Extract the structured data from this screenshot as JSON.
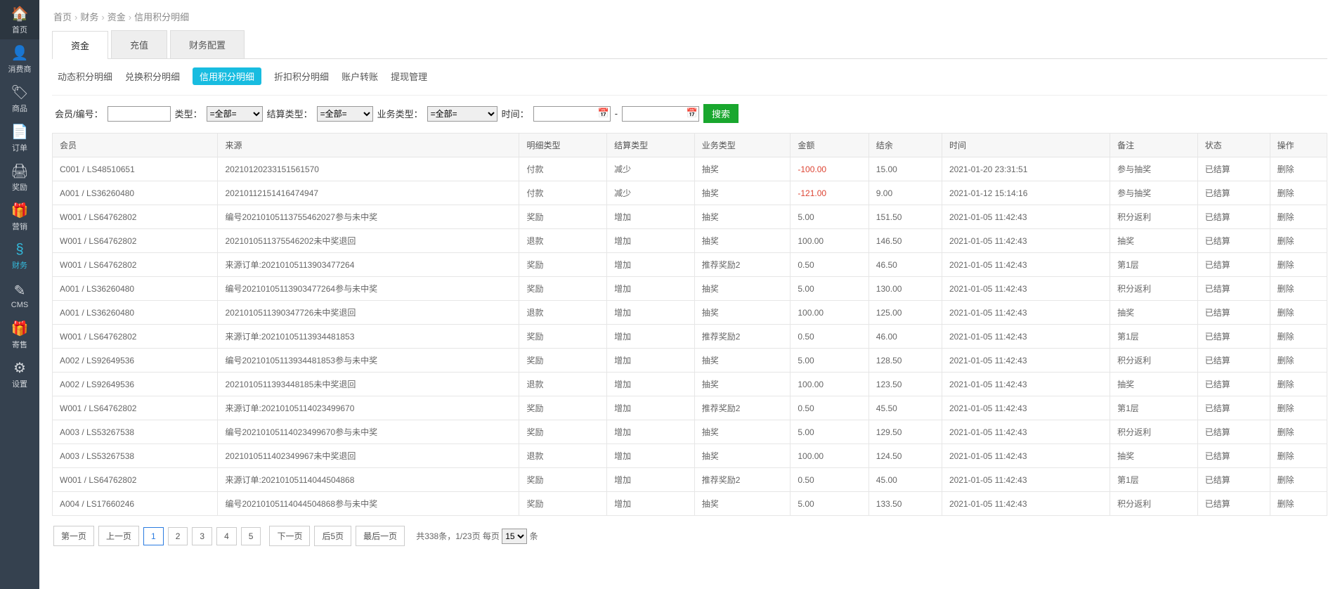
{
  "sidebar": [
    {
      "icon": "🏠",
      "label": "首页",
      "name": "sidebar-home"
    },
    {
      "icon": "👤",
      "label": "消费商",
      "name": "sidebar-consumer"
    },
    {
      "icon": "🏷",
      "label": "商品",
      "name": "sidebar-product"
    },
    {
      "icon": "📄",
      "label": "订单",
      "name": "sidebar-order"
    },
    {
      "icon": "🖨",
      "label": "奖励",
      "name": "sidebar-reward"
    },
    {
      "icon": "🎁",
      "label": "营销",
      "name": "sidebar-marketing"
    },
    {
      "icon": "§",
      "label": "财务",
      "name": "sidebar-finance",
      "active": true
    },
    {
      "icon": "✎",
      "label": "CMS",
      "name": "sidebar-cms"
    },
    {
      "icon": "🎁",
      "label": "寄售",
      "name": "sidebar-consign"
    },
    {
      "icon": "⚙",
      "label": "设置",
      "name": "sidebar-settings"
    }
  ],
  "breadcrumb": [
    "首页",
    "财务",
    "资金",
    "信用积分明细"
  ],
  "tabs1": [
    {
      "label": "资金",
      "active": true
    },
    {
      "label": "充值"
    },
    {
      "label": "财务配置"
    }
  ],
  "tabs2": [
    {
      "label": "动态积分明细"
    },
    {
      "label": "兑换积分明细"
    },
    {
      "label": "信用积分明细",
      "active": true
    },
    {
      "label": "折扣积分明细"
    },
    {
      "label": "账户转账"
    },
    {
      "label": "提现管理"
    }
  ],
  "filters": {
    "member_label": "会员/编号：",
    "type_label": "类型：",
    "type_opt": "=全部=",
    "settle_label": "结算类型：",
    "settle_opt": "=全部=",
    "biz_label": "业务类型：",
    "biz_opt": "=全部=",
    "time_label": "时间：",
    "dash": "-",
    "search": "搜索"
  },
  "columns": [
    "会员",
    "来源",
    "明细类型",
    "结算类型",
    "业务类型",
    "金额",
    "结余",
    "时间",
    "备注",
    "状态",
    "操作"
  ],
  "rows": [
    {
      "member": "C001 / LS48510651",
      "source": "20210120233151561570",
      "detail": "付款",
      "settle": "减少",
      "biz": "抽奖",
      "amount": "-100.00",
      "neg": true,
      "balance": "15.00",
      "time": "2021-01-20 23:31:51",
      "remark": "参与抽奖",
      "status": "已结算",
      "op": "删除"
    },
    {
      "member": "A001 / LS36260480",
      "source": "20210112151416474947",
      "detail": "付款",
      "settle": "减少",
      "biz": "抽奖",
      "amount": "-121.00",
      "neg": true,
      "balance": "9.00",
      "time": "2021-01-12 15:14:16",
      "remark": "参与抽奖",
      "status": "已结算",
      "op": "删除"
    },
    {
      "member": "W001 / LS64762802",
      "source": "编号20210105113755462027参与未中奖",
      "detail": "奖励",
      "settle": "增加",
      "biz": "抽奖",
      "amount": "5.00",
      "balance": "151.50",
      "time": "2021-01-05 11:42:43",
      "remark": "积分返利",
      "status": "已结算",
      "op": "删除"
    },
    {
      "member": "W001 / LS64762802",
      "source": "2021010511375546202未中奖退回",
      "detail": "退款",
      "settle": "增加",
      "biz": "抽奖",
      "amount": "100.00",
      "balance": "146.50",
      "time": "2021-01-05 11:42:43",
      "remark": "抽奖",
      "status": "已结算",
      "op": "删除"
    },
    {
      "member": "W001 / LS64762802",
      "source": "来源订单:20210105113903477264",
      "detail": "奖励",
      "settle": "增加",
      "biz": "推荐奖励2",
      "amount": "0.50",
      "balance": "46.50",
      "time": "2021-01-05 11:42:43",
      "remark": "第1层",
      "status": "已结算",
      "op": "删除"
    },
    {
      "member": "A001 / LS36260480",
      "source": "编号20210105113903477264参与未中奖",
      "detail": "奖励",
      "settle": "增加",
      "biz": "抽奖",
      "amount": "5.00",
      "balance": "130.00",
      "time": "2021-01-05 11:42:43",
      "remark": "积分返利",
      "status": "已结算",
      "op": "删除"
    },
    {
      "member": "A001 / LS36260480",
      "source": "2021010511390347726未中奖退回",
      "detail": "退款",
      "settle": "增加",
      "biz": "抽奖",
      "amount": "100.00",
      "balance": "125.00",
      "time": "2021-01-05 11:42:43",
      "remark": "抽奖",
      "status": "已结算",
      "op": "删除"
    },
    {
      "member": "W001 / LS64762802",
      "source": "来源订单:20210105113934481853",
      "detail": "奖励",
      "settle": "增加",
      "biz": "推荐奖励2",
      "amount": "0.50",
      "balance": "46.00",
      "time": "2021-01-05 11:42:43",
      "remark": "第1层",
      "status": "已结算",
      "op": "删除"
    },
    {
      "member": "A002 / LS92649536",
      "source": "编号20210105113934481853参与未中奖",
      "detail": "奖励",
      "settle": "增加",
      "biz": "抽奖",
      "amount": "5.00",
      "balance": "128.50",
      "time": "2021-01-05 11:42:43",
      "remark": "积分返利",
      "status": "已结算",
      "op": "删除"
    },
    {
      "member": "A002 / LS92649536",
      "source": "2021010511393448185未中奖退回",
      "detail": "退款",
      "settle": "增加",
      "biz": "抽奖",
      "amount": "100.00",
      "balance": "123.50",
      "time": "2021-01-05 11:42:43",
      "remark": "抽奖",
      "status": "已结算",
      "op": "删除"
    },
    {
      "member": "W001 / LS64762802",
      "source": "来源订单:20210105114023499670",
      "detail": "奖励",
      "settle": "增加",
      "biz": "推荐奖励2",
      "amount": "0.50",
      "balance": "45.50",
      "time": "2021-01-05 11:42:43",
      "remark": "第1层",
      "status": "已结算",
      "op": "删除"
    },
    {
      "member": "A003 / LS53267538",
      "source": "编号20210105114023499670参与未中奖",
      "detail": "奖励",
      "settle": "增加",
      "biz": "抽奖",
      "amount": "5.00",
      "balance": "129.50",
      "time": "2021-01-05 11:42:43",
      "remark": "积分返利",
      "status": "已结算",
      "op": "删除"
    },
    {
      "member": "A003 / LS53267538",
      "source": "2021010511402349967未中奖退回",
      "detail": "退款",
      "settle": "增加",
      "biz": "抽奖",
      "amount": "100.00",
      "balance": "124.50",
      "time": "2021-01-05 11:42:43",
      "remark": "抽奖",
      "status": "已结算",
      "op": "删除"
    },
    {
      "member": "W001 / LS64762802",
      "source": "来源订单:20210105114044504868",
      "detail": "奖励",
      "settle": "增加",
      "biz": "推荐奖励2",
      "amount": "0.50",
      "balance": "45.00",
      "time": "2021-01-05 11:42:43",
      "remark": "第1层",
      "status": "已结算",
      "op": "删除"
    },
    {
      "member": "A004 / LS17660246",
      "source": "编号20210105114044504868参与未中奖",
      "detail": "奖励",
      "settle": "增加",
      "biz": "抽奖",
      "amount": "5.00",
      "balance": "133.50",
      "time": "2021-01-05 11:42:43",
      "remark": "积分返利",
      "status": "已结算",
      "op": "删除"
    }
  ],
  "pager": {
    "first": "第一页",
    "prev": "上一页",
    "pages": [
      "1",
      "2",
      "3",
      "4",
      "5"
    ],
    "next": "下一页",
    "next5": "后5页",
    "last": "最后一页",
    "summary_prefix": "共338条，1/23页  每页",
    "per_page": "15",
    "summary_suffix": "条"
  }
}
